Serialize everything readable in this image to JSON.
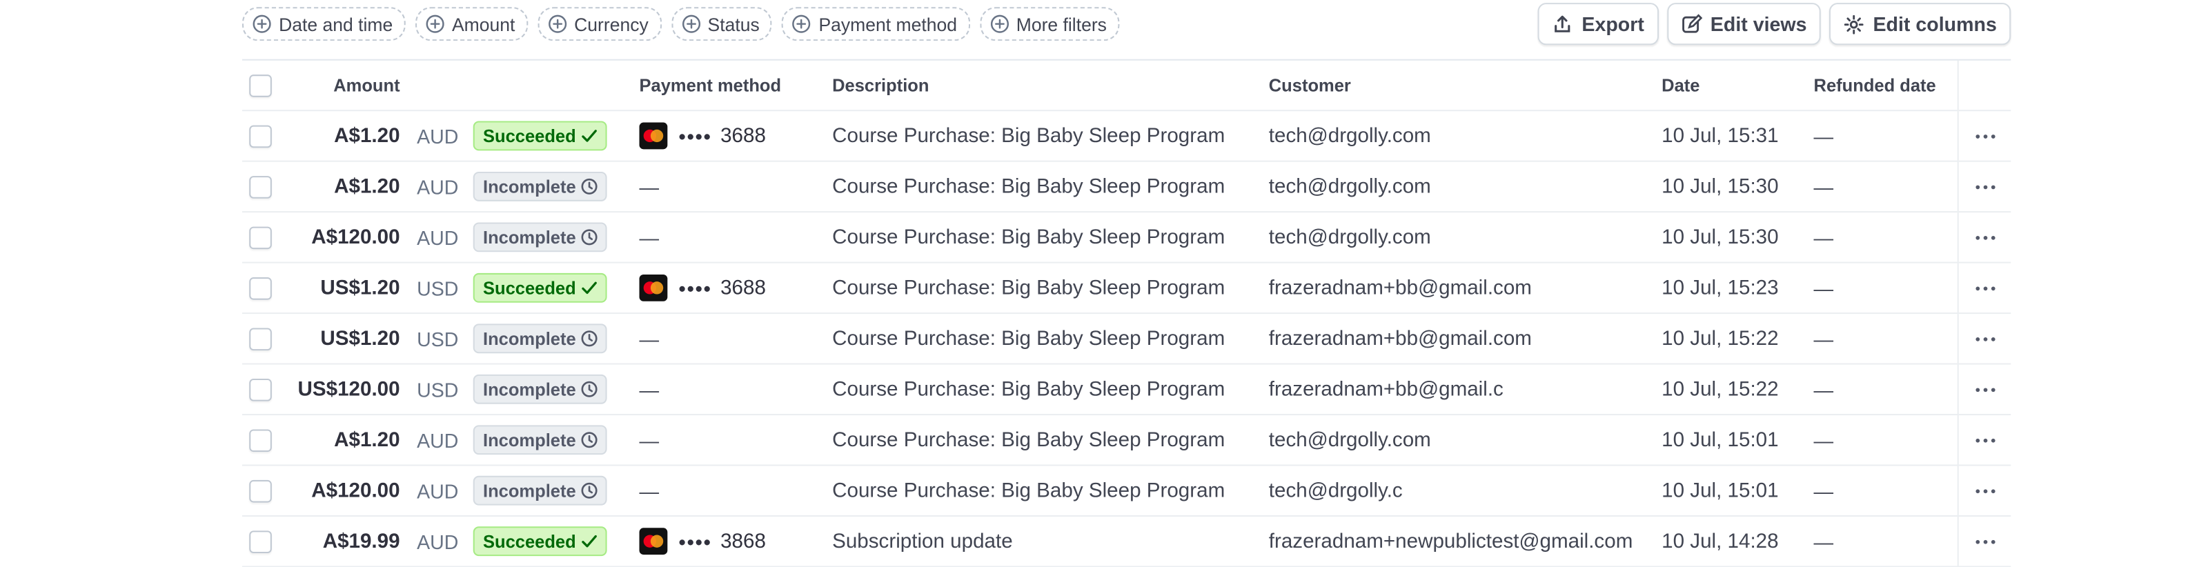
{
  "filters": [
    {
      "label": "Date and time",
      "icon": "plus-circle-icon"
    },
    {
      "label": "Amount",
      "icon": "plus-circle-icon"
    },
    {
      "label": "Currency",
      "icon": "plus-circle-icon"
    },
    {
      "label": "Status",
      "icon": "plus-circle-icon"
    },
    {
      "label": "Payment method",
      "icon": "plus-circle-icon"
    },
    {
      "label": "More filters",
      "icon": "plus-circle-icon"
    }
  ],
  "actions": {
    "export": "Export",
    "edit_views": "Edit views",
    "edit_columns": "Edit columns"
  },
  "columns": {
    "amount": "Amount",
    "payment_method": "Payment method",
    "description": "Description",
    "customer": "Customer",
    "date": "Date",
    "refunded_date": "Refunded date"
  },
  "colors": {
    "succeeded_bg": "#d7f7c2",
    "succeeded_text": "#006908",
    "incomplete_bg": "#ebeef1"
  },
  "rows": [
    {
      "amount": "A$1.20",
      "currency": "AUD",
      "status": "Succeeded",
      "pm_last4": "3688",
      "pm_dots": "••••",
      "description": "Course Purchase: Big Baby Sleep Program",
      "customer": "tech@drgolly.com",
      "date": "10 Jul, 15:31",
      "refunded": "—"
    },
    {
      "amount": "A$1.20",
      "currency": "AUD",
      "status": "Incomplete",
      "pm_last4": "",
      "pm_dots": "",
      "pm_empty": "—",
      "description": "Course Purchase: Big Baby Sleep Program",
      "customer": "tech@drgolly.com",
      "date": "10 Jul, 15:30",
      "refunded": "—"
    },
    {
      "amount": "A$120.00",
      "currency": "AUD",
      "status": "Incomplete",
      "pm_last4": "",
      "pm_dots": "",
      "pm_empty": "—",
      "description": "Course Purchase: Big Baby Sleep Program",
      "customer": "tech@drgolly.com",
      "date": "10 Jul, 15:30",
      "refunded": "—"
    },
    {
      "amount": "US$1.20",
      "currency": "USD",
      "status": "Succeeded",
      "pm_last4": "3688",
      "pm_dots": "••••",
      "description": "Course Purchase: Big Baby Sleep Program",
      "customer": "frazeradnam+bb@gmail.com",
      "date": "10 Jul, 15:23",
      "refunded": "—"
    },
    {
      "amount": "US$1.20",
      "currency": "USD",
      "status": "Incomplete",
      "pm_last4": "",
      "pm_dots": "",
      "pm_empty": "—",
      "description": "Course Purchase: Big Baby Sleep Program",
      "customer": "frazeradnam+bb@gmail.com",
      "date": "10 Jul, 15:22",
      "refunded": "—"
    },
    {
      "amount": "US$120.00",
      "currency": "USD",
      "status": "Incomplete",
      "pm_last4": "",
      "pm_dots": "",
      "pm_empty": "—",
      "description": "Course Purchase: Big Baby Sleep Program",
      "customer": "frazeradnam+bb@gmail.c",
      "date": "10 Jul, 15:22",
      "refunded": "—"
    },
    {
      "amount": "A$1.20",
      "currency": "AUD",
      "status": "Incomplete",
      "pm_last4": "",
      "pm_dots": "",
      "pm_empty": "—",
      "description": "Course Purchase: Big Baby Sleep Program",
      "customer": "tech@drgolly.com",
      "date": "10 Jul, 15:01",
      "refunded": "—"
    },
    {
      "amount": "A$120.00",
      "currency": "AUD",
      "status": "Incomplete",
      "pm_last4": "",
      "pm_dots": "",
      "pm_empty": "—",
      "description": "Course Purchase: Big Baby Sleep Program",
      "customer": "tech@drgolly.c",
      "date": "10 Jul, 15:01",
      "refunded": "—"
    },
    {
      "amount": "A$19.99",
      "currency": "AUD",
      "status": "Succeeded",
      "pm_last4": "3868",
      "pm_dots": "••••",
      "description": "Subscription update",
      "customer": "frazeradnam+newpublictest@gmail.com",
      "date": "10 Jul, 14:28",
      "refunded": "—"
    }
  ]
}
